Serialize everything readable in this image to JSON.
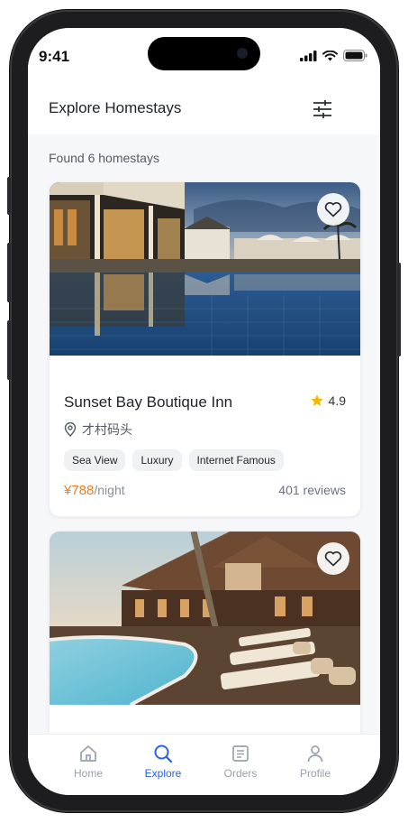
{
  "status": {
    "time": "9:41"
  },
  "header": {
    "title": "Explore Homestays",
    "filter_icon": "sliders-icon"
  },
  "results": {
    "found_text": "Found 6 homestays"
  },
  "listings": [
    {
      "name": "Sunset Bay Boutique Inn",
      "rating": "4.9",
      "location": "才村码头",
      "tags": [
        "Sea View",
        "Luxury",
        "Internet Famous"
      ],
      "price": "¥788",
      "price_unit": "/night",
      "reviews": "401 reviews"
    },
    {
      "name": "",
      "rating": "",
      "location": ""
    }
  ],
  "tabbar": {
    "items": [
      {
        "label": "Home",
        "icon": "home-icon"
      },
      {
        "label": "Explore",
        "icon": "search-icon"
      },
      {
        "label": "Orders",
        "icon": "orders-icon"
      },
      {
        "label": "Profile",
        "icon": "profile-icon"
      }
    ],
    "active": "Explore"
  },
  "colors": {
    "accent": "#2563eb",
    "price": "#f07c24",
    "star": "#f5b800"
  }
}
